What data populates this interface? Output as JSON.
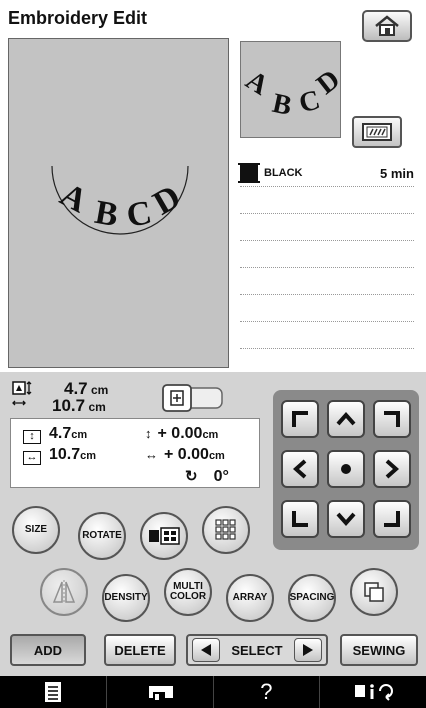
{
  "header": {
    "title": "Embroidery Edit",
    "home_icon": "home-icon"
  },
  "preview": {
    "machine_icon": "machine-view-icon"
  },
  "pattern": {
    "text": "ABCD"
  },
  "thread_list": {
    "rows": [
      {
        "color_name": "BLACK",
        "time": "5 min",
        "color": "#111111"
      }
    ],
    "empty_rows": 7
  },
  "size_readout": {
    "height": "4.7",
    "width": "10.7",
    "unit": "cm"
  },
  "info": {
    "height": "4.7",
    "width": "10.7",
    "unit": "cm",
    "offset_v": "+ 0.00",
    "offset_h": "+ 0.00",
    "rotation": "0°"
  },
  "edit_buttons": {
    "size": "SIZE",
    "rotate": "ROTATE",
    "density": "DENSITY",
    "multi": "MULTI",
    "color": "COLOR",
    "array": "ARRAY",
    "spacing": "SPACING"
  },
  "actions": {
    "add": "ADD",
    "delete": "DELETE",
    "select": "SELECT",
    "sewing": "SEWING"
  },
  "bottom_bar": {
    "help": "?"
  }
}
